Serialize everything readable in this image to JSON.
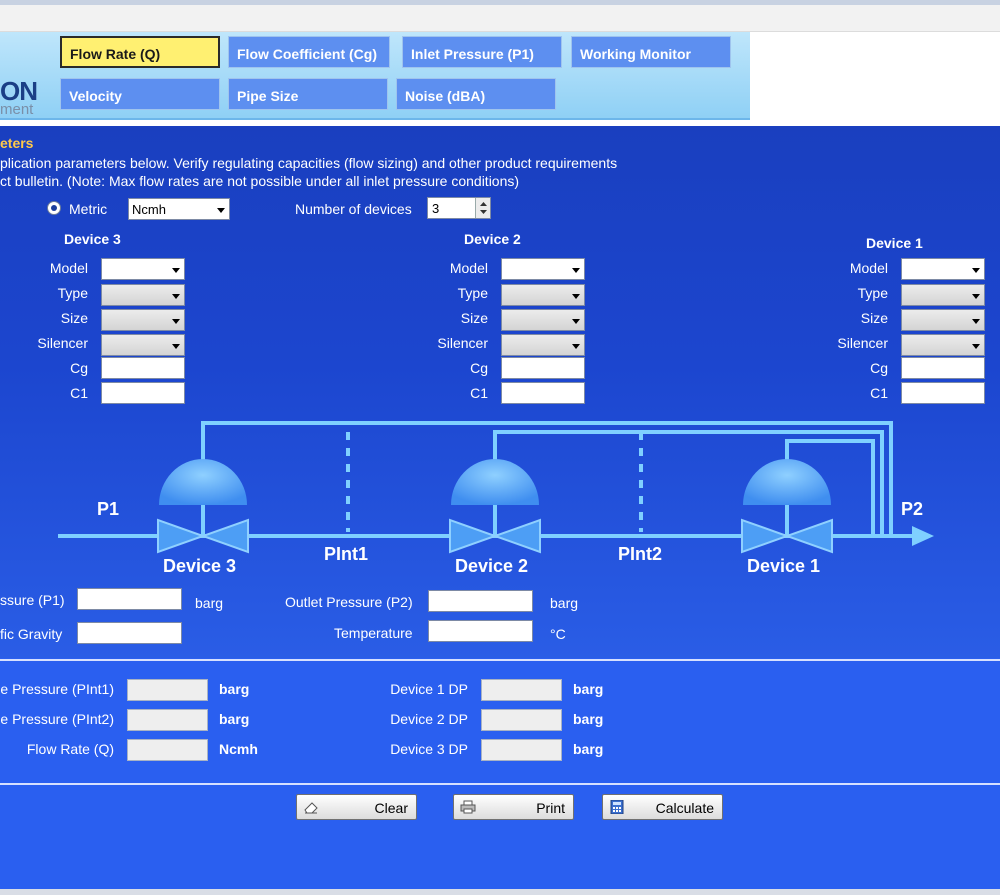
{
  "logo": {
    "text": "ON",
    "subtext": "ment"
  },
  "tabs": [
    {
      "label": "Flow Rate (Q)",
      "active": true
    },
    {
      "label": "Flow Coefficient (Cg)"
    },
    {
      "label": "Inlet Pressure (P1)"
    },
    {
      "label": "Working Monitor"
    },
    {
      "label": "Velocity"
    },
    {
      "label": "Pipe Size"
    },
    {
      "label": "Noise (dBA)"
    }
  ],
  "section": {
    "title": "eters",
    "note_line1": "plication parameters below. Verify regulating capacities (flow sizing) and other product requirements",
    "note_line2": "ct bulletin. (Note: Max flow rates are not possible under all inlet pressure conditions)"
  },
  "units": {
    "radio_label": "Metric",
    "flow_unit_selected": "Ncmh",
    "num_devices_label": "Number of devices",
    "num_devices_value": "3"
  },
  "field_labels": {
    "model": "Model",
    "type": "Type",
    "size": "Size",
    "silencer": "Silencer",
    "cg": "Cg",
    "c1": "C1"
  },
  "devices": [
    {
      "title": "Device 3"
    },
    {
      "title": "Device 2"
    },
    {
      "title": "Device 1"
    }
  ],
  "diagram": {
    "p1": "P1",
    "p2": "P2",
    "pint1": "PInt1",
    "pint2": "PInt2",
    "device3": "Device 3",
    "device2": "Device 2",
    "device1": "Device 1"
  },
  "conditions": {
    "inlet_label": "ssure (P1)",
    "inlet_unit": "barg",
    "gravity_label": "fic Gravity",
    "outlet_label": "Outlet Pressure (P2)",
    "outlet_unit": "barg",
    "temp_label": "Temperature",
    "temp_unit": "°C"
  },
  "results": {
    "pint1_label": "e Pressure (PInt1)",
    "pint1_unit": "barg",
    "pint2_label": "e Pressure (PInt2)",
    "pint2_unit": "barg",
    "flow_label": "Flow Rate (Q)",
    "flow_unit": "Ncmh",
    "dp1_label": "Device 1 DP",
    "dp1_unit": "barg",
    "dp2_label": "Device 2 DP",
    "dp2_unit": "barg",
    "dp3_label": "Device 3 DP",
    "dp3_unit": "barg"
  },
  "buttons": {
    "clear": "Clear",
    "print": "Print",
    "calculate": "Calculate"
  },
  "colors": {
    "accent": "#ffc94a",
    "panel": "#1c46cf",
    "tab": "#5d8ff0",
    "active_tab": "#fff071"
  }
}
